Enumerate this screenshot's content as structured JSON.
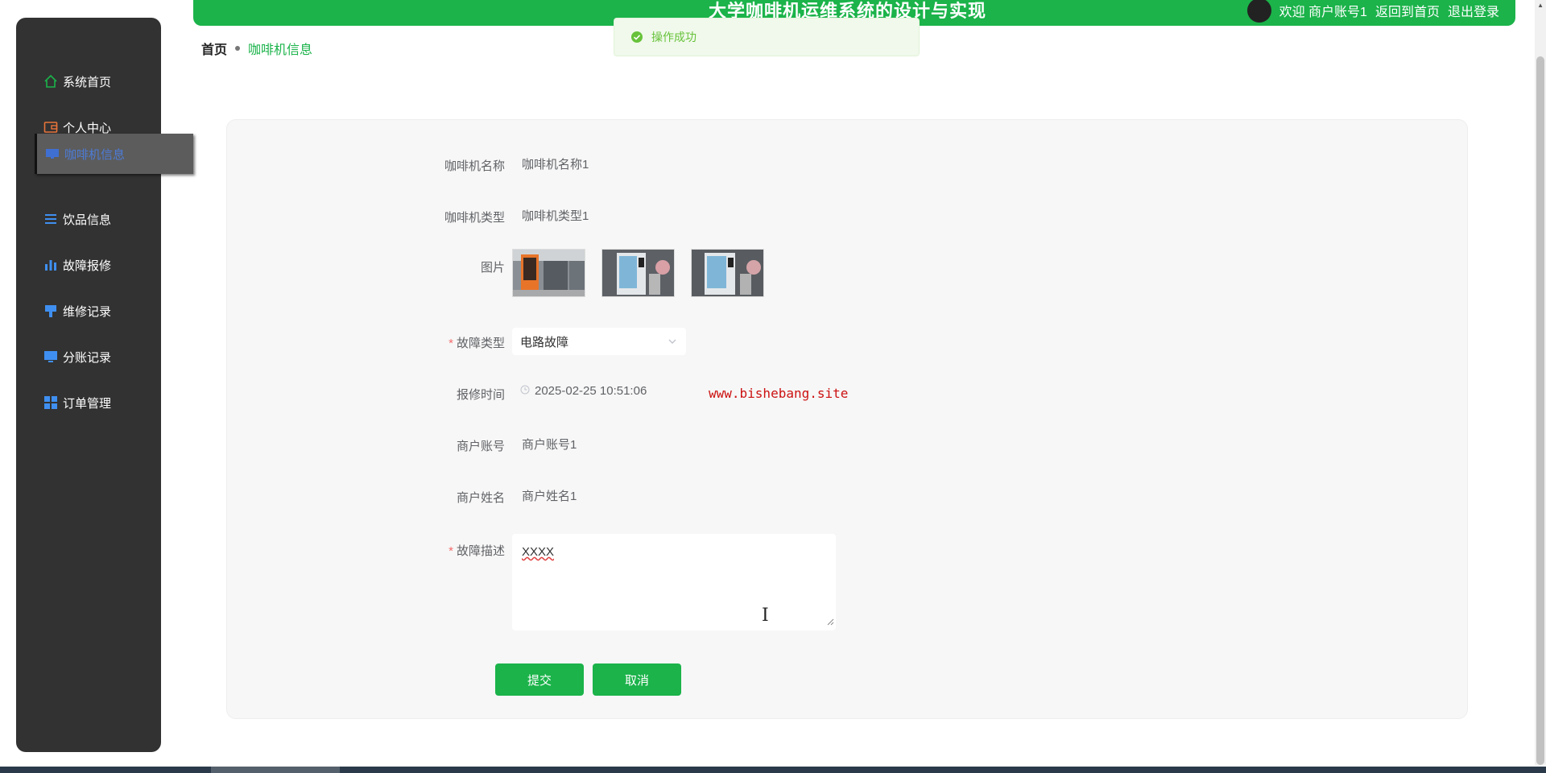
{
  "header": {
    "title": "大学咖啡机运维系统的设计与实现",
    "welcome": "欢迎 商户账号1",
    "back_home": "返回到首页",
    "logout": "退出登录"
  },
  "toast": {
    "message": "操作成功"
  },
  "sidebar": {
    "items": [
      {
        "label": "系统首页",
        "icon": "home-icon"
      },
      {
        "label": "个人中心",
        "icon": "wallet-icon"
      },
      {
        "label": "咖啡机信息",
        "icon": "monitor-icon"
      },
      {
        "label": "饮品信息",
        "icon": "list-icon"
      },
      {
        "label": "故障报修",
        "icon": "bar-chart-icon"
      },
      {
        "label": "维修记录",
        "icon": "brush-icon"
      },
      {
        "label": "分账记录",
        "icon": "monitor-icon"
      },
      {
        "label": "订单管理",
        "icon": "grid-icon"
      }
    ]
  },
  "breadcrumb": {
    "home": "首页",
    "current": "咖啡机信息"
  },
  "form": {
    "machine_name": {
      "label": "咖啡机名称",
      "value": "咖啡机名称1"
    },
    "machine_type": {
      "label": "咖啡机类型",
      "value": "咖啡机类型1"
    },
    "images": {
      "label": "图片"
    },
    "fault_type": {
      "label": "故障类型",
      "value": "电路故障"
    },
    "report_time": {
      "label": "报修时间",
      "value": "2025-02-25 10:51:06"
    },
    "merchant_account": {
      "label": "商户账号",
      "value": "商户账号1"
    },
    "merchant_name": {
      "label": "商户姓名",
      "value": "商户姓名1"
    },
    "fault_desc": {
      "label": "故障描述",
      "value": "XXXX"
    },
    "submit": "提交",
    "cancel": "取消"
  },
  "watermark": "www.bishebang.site",
  "colors": {
    "primary": "#1bb34a",
    "sidebar": "#323232",
    "success_text": "#67c23a",
    "watermark": "#cc1111"
  }
}
